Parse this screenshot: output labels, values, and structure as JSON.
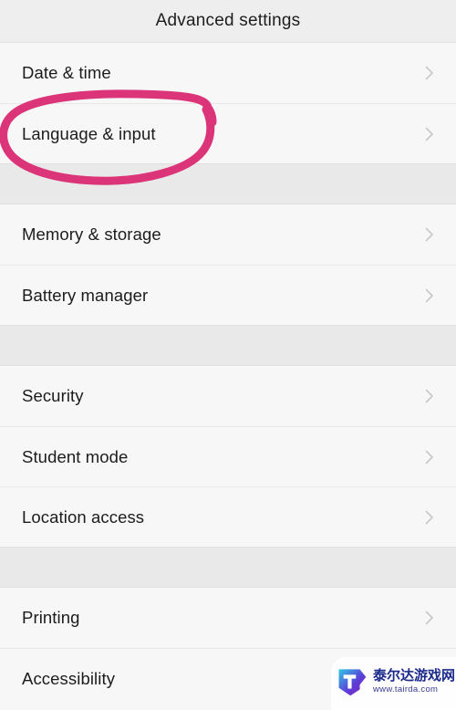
{
  "header": {
    "title": "Advanced settings"
  },
  "list": {
    "chevron_icon": "chevron-right-icon",
    "groups": [
      {
        "rows": [
          {
            "label": "Date & time"
          },
          {
            "label": "Language & input"
          }
        ]
      },
      {
        "rows": [
          {
            "label": "Memory & storage"
          },
          {
            "label": "Battery manager"
          }
        ]
      },
      {
        "rows": [
          {
            "label": "Security"
          },
          {
            "label": "Student mode"
          },
          {
            "label": "Location access"
          }
        ]
      },
      {
        "rows": [
          {
            "label": "Printing"
          },
          {
            "label": "Accessibility"
          }
        ]
      }
    ]
  },
  "annotation": {
    "name": "pink-circle-highlight",
    "target": "Language & input",
    "color": "#dc3478"
  },
  "watermark": {
    "site_name": "泰尔达游戏网",
    "url": "www.tairda.com",
    "logo_letter": "T",
    "logo_color_start": "#2ec8e6",
    "logo_color_end": "#7b2fd4"
  },
  "colors": {
    "header_bg": "#eeeeee",
    "row_bg": "#f7f7f7",
    "group_gap_bg": "#e9e9e9",
    "divider": "#e8e8e8",
    "text": "#1c1c1c",
    "chevron": "#c8c8c8",
    "annotation_pink": "#dc3478"
  }
}
